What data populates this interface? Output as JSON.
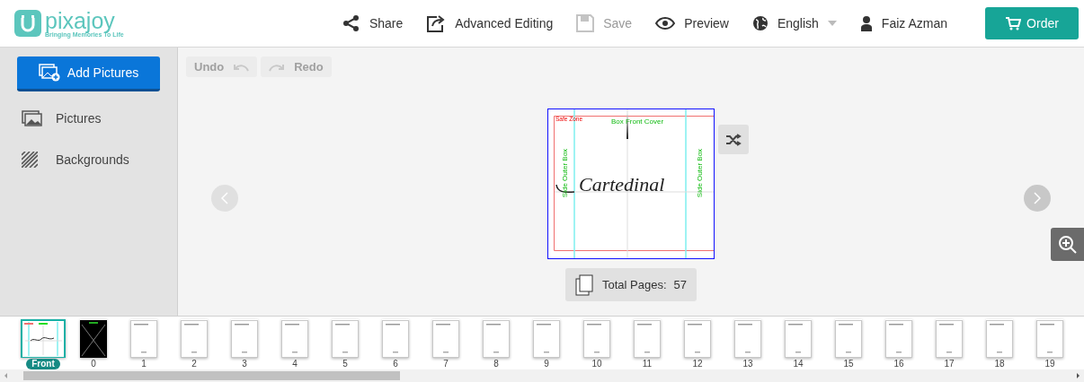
{
  "logo": {
    "name": "pixajoy",
    "tagline": "Bringing Memories To Life"
  },
  "toolbar": [
    {
      "kind": "share",
      "label": "Share",
      "disabled": false
    },
    {
      "kind": "edit",
      "label": "Advanced Editing",
      "disabled": false
    },
    {
      "kind": "save",
      "label": "Save",
      "disabled": true
    },
    {
      "kind": "preview",
      "label": "Preview",
      "disabled": false
    },
    {
      "kind": "language",
      "label": "English",
      "disabled": false
    },
    {
      "kind": "user",
      "label": "Faiz Azman",
      "disabled": false
    }
  ],
  "order_button": "Order",
  "sidebar": {
    "add_button": "Add Pictures",
    "items": [
      {
        "kind": "pictures",
        "label": "Pictures"
      },
      {
        "kind": "backgrounds",
        "label": "Backgrounds"
      }
    ]
  },
  "history": [
    {
      "kind": "undo",
      "label": "Undo",
      "disabled": true
    },
    {
      "kind": "redo",
      "label": "Redo",
      "disabled": true
    }
  ],
  "page": {
    "safe_zone": "Safe Zone",
    "front_label": "Box Front Cover",
    "side_labels": [
      "Side Outer Box",
      "Side Outer Box"
    ],
    "title": "Cartedinal"
  },
  "total_pages": {
    "label": "Total Pages:",
    "value": "57"
  },
  "thumbnails": [
    {
      "kind": "front",
      "label": "Front",
      "selected": true
    },
    {
      "kind": "cover",
      "label": "0",
      "selected": false
    },
    {
      "kind": "page",
      "label": "1",
      "selected": false
    },
    {
      "kind": "page",
      "label": "2",
      "selected": false
    },
    {
      "kind": "page",
      "label": "3",
      "selected": false
    },
    {
      "kind": "page",
      "label": "4",
      "selected": false
    },
    {
      "kind": "page",
      "label": "5",
      "selected": false
    },
    {
      "kind": "page",
      "label": "6",
      "selected": false
    },
    {
      "kind": "page",
      "label": "7",
      "selected": false
    },
    {
      "kind": "page",
      "label": "8",
      "selected": false
    },
    {
      "kind": "page",
      "label": "9",
      "selected": false
    },
    {
      "kind": "page",
      "label": "10",
      "selected": false
    },
    {
      "kind": "page",
      "label": "11",
      "selected": false
    },
    {
      "kind": "page",
      "label": "12",
      "selected": false
    },
    {
      "kind": "page",
      "label": "13",
      "selected": false
    },
    {
      "kind": "page",
      "label": "14",
      "selected": false
    },
    {
      "kind": "page",
      "label": "15",
      "selected": false
    },
    {
      "kind": "page",
      "label": "16",
      "selected": false
    },
    {
      "kind": "page",
      "label": "17",
      "selected": false
    },
    {
      "kind": "page",
      "label": "18",
      "selected": false
    },
    {
      "kind": "page",
      "label": "19",
      "selected": false
    }
  ]
}
